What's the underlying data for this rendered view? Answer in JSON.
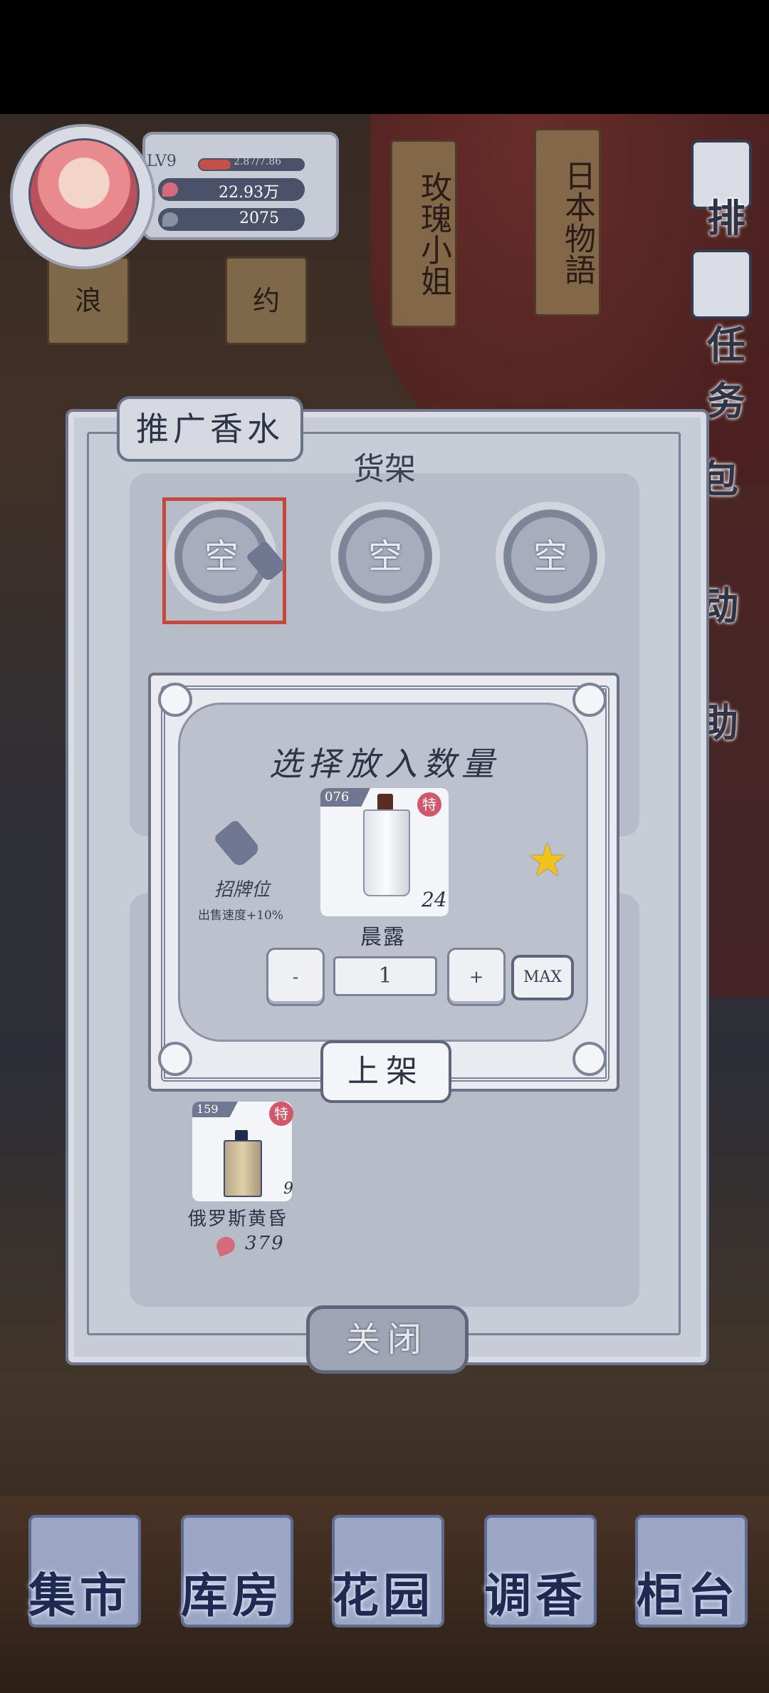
{
  "hud": {
    "level": "LV9",
    "exp": "2.87/7.86",
    "currency_1": "22.93万",
    "currency_2": "2075",
    "colors": {
      "currency_1_icon": "#d46a7a",
      "currency_2_icon": "#4b5168"
    }
  },
  "scene": {
    "sign_1": "玫瑰小姐",
    "sign_2": "日本物語",
    "sign_3": "浪",
    "sign_4": "约"
  },
  "right_menu": {
    "rank": "排行",
    "task": "任务",
    "bag": "包",
    "event": "动",
    "help": "助"
  },
  "panel": {
    "title": "推广香水",
    "shelf_label": "货架",
    "slots": [
      "空",
      "空",
      "空"
    ],
    "close_label": "关闭"
  },
  "dialog": {
    "title": "选择放入数量",
    "promo_label": "招牌位",
    "promo_desc": "出售速度+10%",
    "item": {
      "id": "076",
      "badge": "特",
      "count": "24",
      "name": "晨露"
    },
    "minus_label": "-",
    "quantity": "1",
    "plus_label": "+",
    "max_label": "MAX",
    "confirm_label": "上架"
  },
  "inventory": [
    {
      "id": "159",
      "badge": "特",
      "count": "9",
      "name": "俄罗斯黄昏",
      "price": "379"
    }
  ],
  "nav": [
    "集市",
    "库房",
    "花园",
    "调香",
    "柜台"
  ],
  "accent": {
    "selected_slot": "#c7473c",
    "star": "#f2c318",
    "badge": "#d4566b"
  }
}
